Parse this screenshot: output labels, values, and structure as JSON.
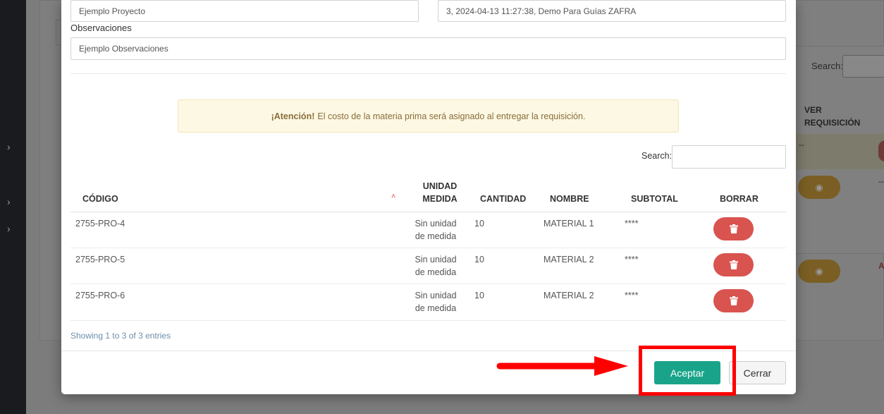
{
  "form": {
    "proyecto_value": "Ejemplo Proyecto",
    "requisicion_value": "3, 2024-04-13 11:27:38, Demo Para Guías ZAFRA",
    "observaciones_label": "Observaciones",
    "observaciones_value": "Ejemplo Observaciones"
  },
  "alert": {
    "strong": "¡Atención!",
    "text": "El costo de la materia prima será asignado al entregar la requisición."
  },
  "search": {
    "label": "Search:"
  },
  "table": {
    "headers": {
      "codigo": "CÓDIGO",
      "unidad_line1": "UNIDAD",
      "unidad_line2": "MEDIDA",
      "cantidad": "CANTIDAD",
      "nombre": "NOMBRE",
      "subtotal": "SUBTOTAL",
      "borrar": "BORRAR"
    },
    "rows": [
      {
        "codigo": "2755-PRO-4",
        "unidad_line1": "Sin unidad",
        "unidad_line2": "de medida",
        "cantidad": "10",
        "nombre": "MATERIAL 1",
        "subtotal": "****"
      },
      {
        "codigo": "2755-PRO-5",
        "unidad_line1": "Sin unidad",
        "unidad_line2": "de medida",
        "cantidad": "10",
        "nombre": "MATERIAL 2",
        "subtotal": "****"
      },
      {
        "codigo": "2755-PRO-6",
        "unidad_line1": "Sin unidad",
        "unidad_line2": "de medida",
        "cantidad": "10",
        "nombre": "MATERIAL 2",
        "subtotal": "****"
      }
    ],
    "showing": "Showing 1 to 3 of 3 entries"
  },
  "footer": {
    "accept_label": "Aceptar",
    "close_label": "Cerrar"
  },
  "background": {
    "search_label": "Search:",
    "col_line1": "VER",
    "col_line2": "REQUISICIÓN",
    "dash_1": "--",
    "dash_2": "--",
    "letter": "A"
  },
  "icons": {
    "chevron": "chevron-right-icon",
    "sort": "sort-asc-icon",
    "delete": "trash-icon",
    "eye": "eye-icon",
    "arrow": "arrow-right-icon"
  },
  "colors": {
    "accept": "#19a48a",
    "delete": "#d9534f",
    "alert_bg": "#fcf8e3",
    "annotation": "#ff0000"
  }
}
